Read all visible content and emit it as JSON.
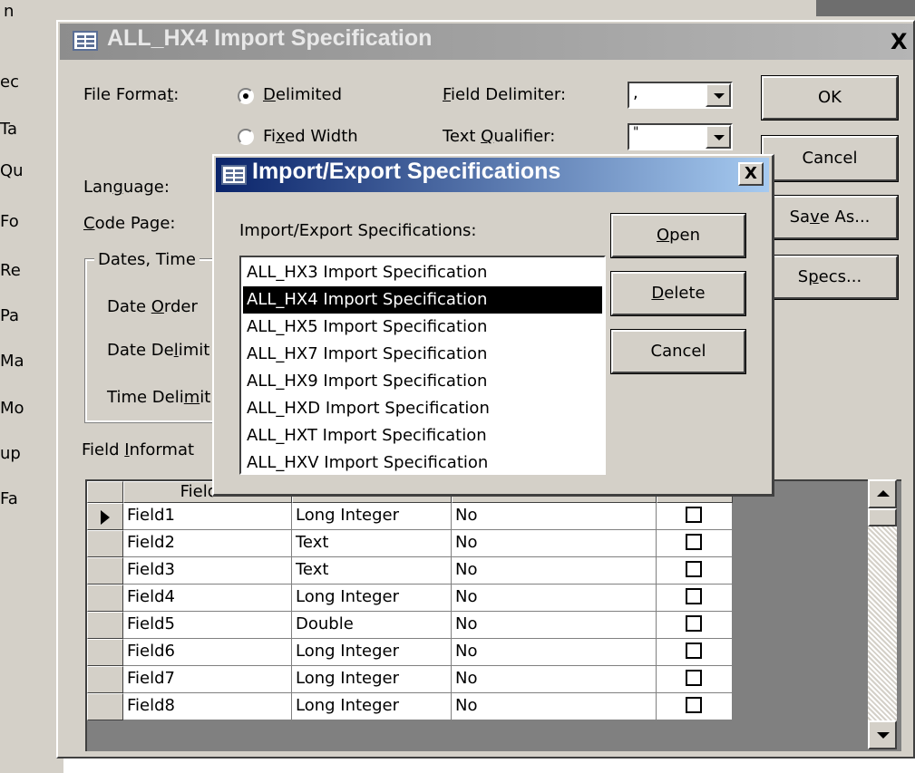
{
  "background_app": {
    "sidebar_fragments": [
      "ec",
      "Ta",
      "Qu",
      "Fo",
      "Re",
      "Pa",
      "Ma",
      "Mo",
      "up",
      "Fa"
    ],
    "toolbar_fragment": "n"
  },
  "main_dialog": {
    "title": "ALL_HX4 Import Specification",
    "close_label": "X",
    "file_format_label": "File Forma",
    "file_format_underline": "t",
    "file_format_colon": ":",
    "radio_delimited_u": "D",
    "radio_delimited_rest": "elimited",
    "radio_fixed_pre": "Fi",
    "radio_fixed_u": "x",
    "radio_fixed_rest": "ed Width",
    "field_delimiter_u": "F",
    "field_delimiter_rest": "ield Delimiter:",
    "field_delimiter_value": ",",
    "text_qualifier_pre": "Text ",
    "text_qualifier_u": "Q",
    "text_qualifier_rest": "ualifier:",
    "text_qualifier_value": "\"",
    "language_pre": "Lan",
    "language_u": "g",
    "language_rest": "uage:",
    "code_page_u": "C",
    "code_page_rest": "ode Page:",
    "dates_group_title": "Dates, Time",
    "date_order_pre": "Date ",
    "date_order_u": "O",
    "date_order_rest": "rder",
    "date_delim_pre": "Date De",
    "date_delim_u": "l",
    "date_delim_rest": "imit",
    "time_delim_pre": "Time Deli",
    "time_delim_u": "m",
    "time_delim_rest": "it",
    "field_info_pre": "Field ",
    "field_info_u": "I",
    "field_info_rest": "nformat",
    "ok_label": "OK",
    "cancel_label": "Cancel",
    "save_as_pre": "Sa",
    "save_as_u": "v",
    "save_as_rest": "e As...",
    "specs_pre": "S",
    "specs_u": "p",
    "specs_rest": "ecs..."
  },
  "grid": {
    "header_field_name": "Field N",
    "rows": [
      {
        "name": "Field1",
        "type": "Long Integer",
        "indexed": "No"
      },
      {
        "name": "Field2",
        "type": "Text",
        "indexed": "No"
      },
      {
        "name": "Field3",
        "type": "Text",
        "indexed": "No"
      },
      {
        "name": "Field4",
        "type": "Long Integer",
        "indexed": "No"
      },
      {
        "name": "Field5",
        "type": "Double",
        "indexed": "No"
      },
      {
        "name": "Field6",
        "type": "Long Integer",
        "indexed": "No"
      },
      {
        "name": "Field7",
        "type": "Long Integer",
        "indexed": "No"
      },
      {
        "name": "Field8",
        "type": "Long Integer",
        "indexed": "No"
      }
    ]
  },
  "modal": {
    "title": "Import/Export Specifications",
    "close_label": "X",
    "list_label": "Import/Export Specifications:",
    "items": [
      "ALL_HX3 Import Specification",
      "ALL_HX4 Import Specification",
      "ALL_HX5 Import Specification",
      "ALL_HX7 Import Specification",
      "ALL_HX9 Import Specification",
      "ALL_HXD Import Specification",
      "ALL_HXT Import Specification",
      "ALL_HXV Import Specification"
    ],
    "selected_index": 1,
    "open_u": "O",
    "open_rest": "pen",
    "delete_u": "D",
    "delete_rest": "elete",
    "cancel_label": "Cancel"
  }
}
